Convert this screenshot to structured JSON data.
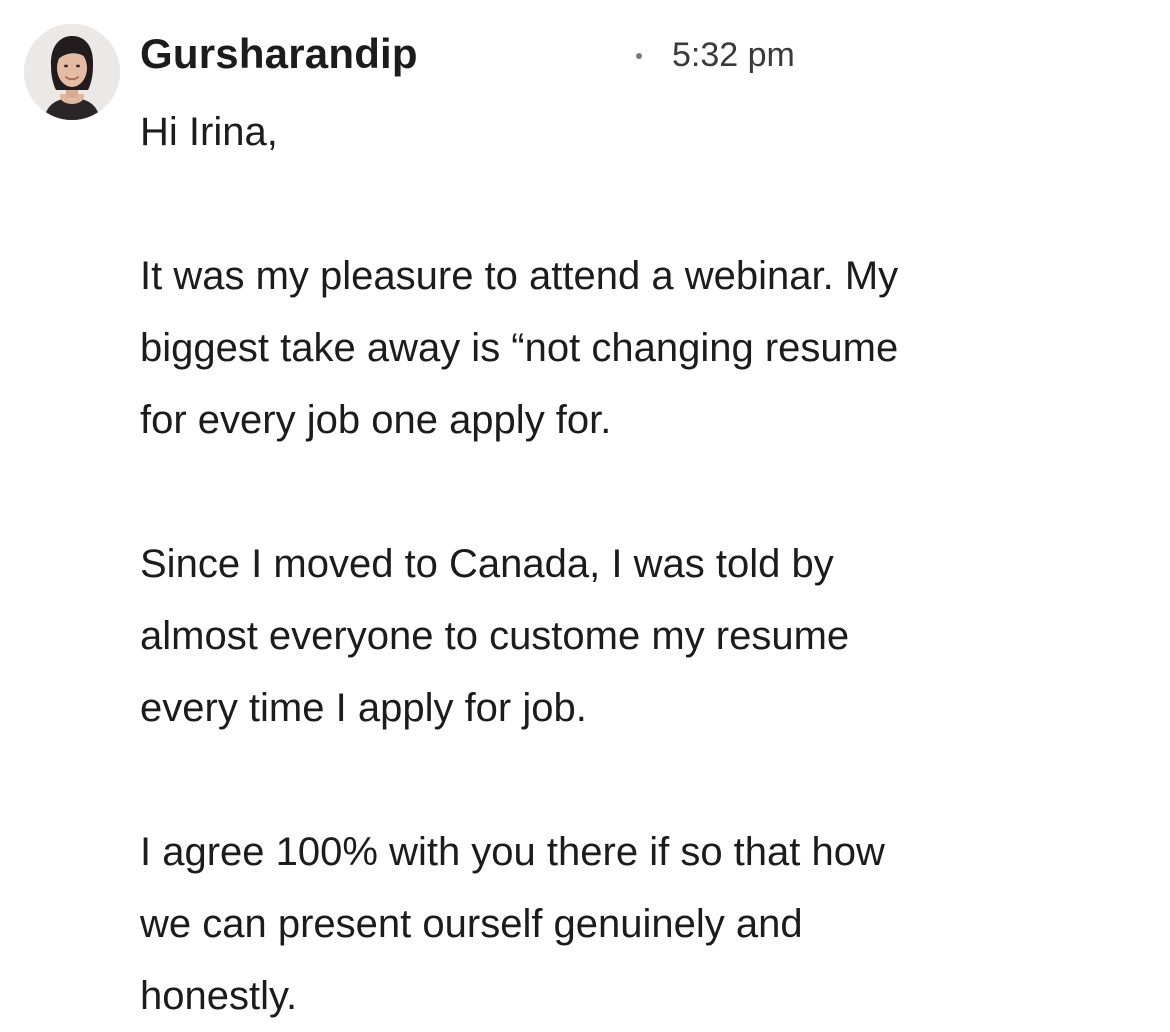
{
  "message": {
    "sender": "Gursharandip",
    "time": "5:32 pm",
    "avatar_icon": "person-photo-avatar",
    "greeting": "Hi Irina,",
    "paragraphs": [
      {
        "lines": [
          "It was my pleasure to attend a webinar. My",
          "biggest take away is “not changing resume",
          "for every job one apply for."
        ]
      },
      {
        "lines": [
          "Since I moved to Canada, I was told by",
          "almost everyone to custome my resume",
          "every time I apply for job."
        ]
      },
      {
        "lines": [
          "I agree 100% with you there if so that how",
          "we can present ourself genuinely and",
          "honestly."
        ]
      }
    ]
  },
  "colors": {
    "text": "#1c1c1e",
    "meta": "#3a3a3c",
    "background": "#ffffff"
  }
}
